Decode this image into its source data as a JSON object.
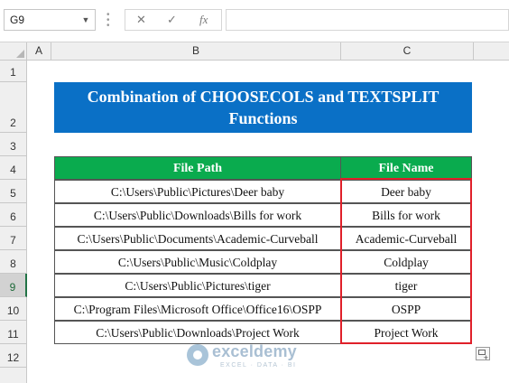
{
  "formula_bar": {
    "name_box": "G9",
    "cancel_icon": "✕",
    "enter_icon": "✓",
    "fx_label": "fx",
    "formula": ""
  },
  "columns": [
    "A",
    "B",
    "C"
  ],
  "rows": [
    "1",
    "2",
    "3",
    "4",
    "5",
    "6",
    "7",
    "8",
    "9",
    "10",
    "11",
    "12"
  ],
  "selected_row": "9",
  "title": "Combination of CHOOSECOLS and TEXTSPLIT Functions",
  "table": {
    "headers": [
      "File Path",
      "File Name"
    ],
    "rows": [
      [
        "C:\\Users\\Public\\Pictures\\Deer baby",
        "Deer baby"
      ],
      [
        "C:\\Users\\Public\\Downloads\\Bills for work",
        "Bills for work"
      ],
      [
        "C:\\Users\\Public\\Documents\\Academic-Curveball",
        "Academic-Curveball"
      ],
      [
        "C:\\Users\\Public\\Music\\Coldplay",
        "Coldplay"
      ],
      [
        "C:\\Users\\Public\\Pictures\\tiger",
        "tiger"
      ],
      [
        "C:\\Program Files\\Microsoft Office\\Office16\\OSPP",
        "OSPP"
      ],
      [
        "C:\\Users\\Public\\Downloads\\Project Work",
        "Project Work"
      ]
    ]
  },
  "watermark": {
    "name": "exceldemy",
    "tagline": "EXCEL · DATA · BI"
  },
  "colors": {
    "title_bg": "#0a70c6",
    "header_bg": "#0aab4e",
    "highlight_border": "#e0202a"
  }
}
